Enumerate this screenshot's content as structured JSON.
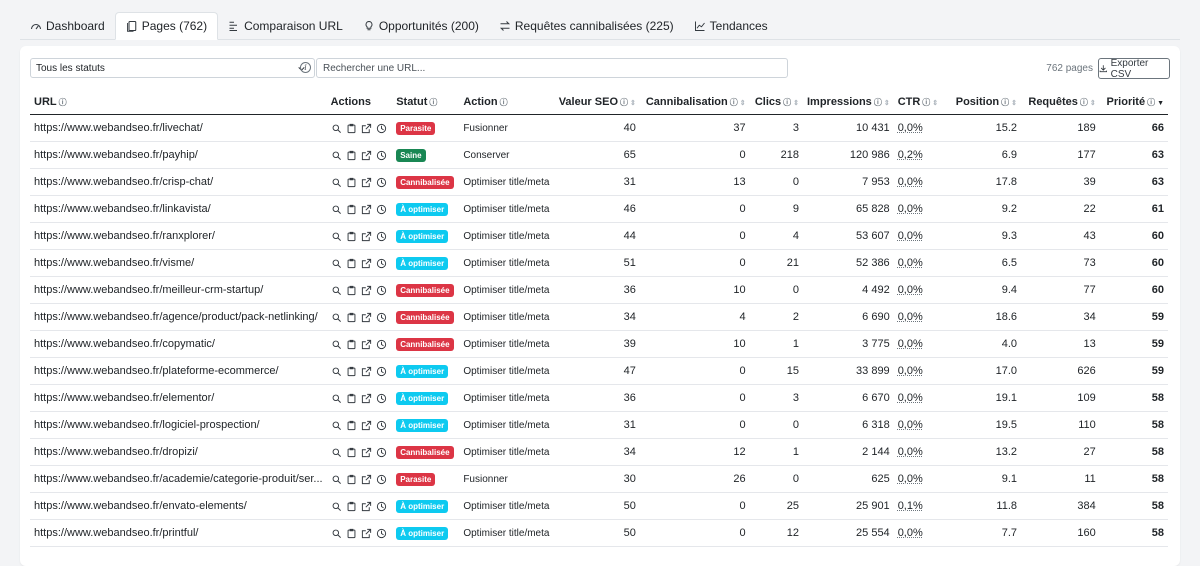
{
  "tabs": [
    {
      "label": "Dashboard",
      "icon": "gauge-icon"
    },
    {
      "label": "Pages (762)",
      "icon": "pages-icon",
      "active": true
    },
    {
      "label": "Comparaison URL",
      "icon": "compare-icon"
    },
    {
      "label": "Opportunités (200)",
      "icon": "lightbulb-icon"
    },
    {
      "label": "Requêtes cannibalisées (225)",
      "icon": "swap-icon"
    },
    {
      "label": "Tendances",
      "icon": "trend-icon"
    }
  ],
  "toolbar": {
    "status_filter": "Tous les statuts",
    "search_placeholder": "Rechercher une URL...",
    "count": "762 pages",
    "export_label": "Exporter CSV"
  },
  "columns": [
    "URL",
    "Actions",
    "Statut",
    "Action",
    "Valeur SEO",
    "Cannibalisation",
    "Clics",
    "Impressions",
    "CTR",
    "Position",
    "Requêtes",
    "Priorité"
  ],
  "status_colors": {
    "Parasite": "#dc3545",
    "Saine": "#198754",
    "Cannibalisée": "#dc3545",
    "À optimiser": "#0dcaf0"
  },
  "rows": [
    {
      "url": "https://www.webandseo.fr/livechat/",
      "statut": "Parasite",
      "action": "Fusionner",
      "seo": "40",
      "canni": "37",
      "clics": "3",
      "impr": "10 431",
      "ctr": "0,0%",
      "pos": "15.2",
      "req": "189",
      "prio": "66"
    },
    {
      "url": "https://www.webandseo.fr/payhip/",
      "statut": "Saine",
      "action": "Conserver",
      "seo": "65",
      "canni": "0",
      "clics": "218",
      "impr": "120 986",
      "ctr": "0,2%",
      "pos": "6.9",
      "req": "177",
      "prio": "63"
    },
    {
      "url": "https://www.webandseo.fr/crisp-chat/",
      "statut": "Cannibalisée",
      "action": "Optimiser title/meta",
      "seo": "31",
      "canni": "13",
      "clics": "0",
      "impr": "7 953",
      "ctr": "0,0%",
      "pos": "17.8",
      "req": "39",
      "prio": "63"
    },
    {
      "url": "https://www.webandseo.fr/linkavista/",
      "statut": "À optimiser",
      "action": "Optimiser title/meta",
      "seo": "46",
      "canni": "0",
      "clics": "9",
      "impr": "65 828",
      "ctr": "0,0%",
      "pos": "9.2",
      "req": "22",
      "prio": "61"
    },
    {
      "url": "https://www.webandseo.fr/ranxplorer/",
      "statut": "À optimiser",
      "action": "Optimiser title/meta",
      "seo": "44",
      "canni": "0",
      "clics": "4",
      "impr": "53 607",
      "ctr": "0,0%",
      "pos": "9.3",
      "req": "43",
      "prio": "60"
    },
    {
      "url": "https://www.webandseo.fr/visme/",
      "statut": "À optimiser",
      "action": "Optimiser title/meta",
      "seo": "51",
      "canni": "0",
      "clics": "21",
      "impr": "52 386",
      "ctr": "0,0%",
      "pos": "6.5",
      "req": "73",
      "prio": "60"
    },
    {
      "url": "https://www.webandseo.fr/meilleur-crm-startup/",
      "statut": "Cannibalisée",
      "action": "Optimiser title/meta",
      "seo": "36",
      "canni": "10",
      "clics": "0",
      "impr": "4 492",
      "ctr": "0,0%",
      "pos": "9.4",
      "req": "77",
      "prio": "60"
    },
    {
      "url": "https://www.webandseo.fr/agence/product/pack-netlinking/",
      "statut": "Cannibalisée",
      "action": "Optimiser title/meta",
      "seo": "34",
      "canni": "4",
      "clics": "2",
      "impr": "6 690",
      "ctr": "0,0%",
      "pos": "18.6",
      "req": "34",
      "prio": "59"
    },
    {
      "url": "https://www.webandseo.fr/copymatic/",
      "statut": "Cannibalisée",
      "action": "Optimiser title/meta",
      "seo": "39",
      "canni": "10",
      "clics": "1",
      "impr": "3 775",
      "ctr": "0,0%",
      "pos": "4.0",
      "req": "13",
      "prio": "59"
    },
    {
      "url": "https://www.webandseo.fr/plateforme-ecommerce/",
      "statut": "À optimiser",
      "action": "Optimiser title/meta",
      "seo": "47",
      "canni": "0",
      "clics": "15",
      "impr": "33 899",
      "ctr": "0,0%",
      "pos": "17.0",
      "req": "626",
      "prio": "59"
    },
    {
      "url": "https://www.webandseo.fr/elementor/",
      "statut": "À optimiser",
      "action": "Optimiser title/meta",
      "seo": "36",
      "canni": "0",
      "clics": "3",
      "impr": "6 670",
      "ctr": "0,0%",
      "pos": "19.1",
      "req": "109",
      "prio": "58"
    },
    {
      "url": "https://www.webandseo.fr/logiciel-prospection/",
      "statut": "À optimiser",
      "action": "Optimiser title/meta",
      "seo": "31",
      "canni": "0",
      "clics": "0",
      "impr": "6 318",
      "ctr": "0,0%",
      "pos": "19.5",
      "req": "110",
      "prio": "58"
    },
    {
      "url": "https://www.webandseo.fr/dropizi/",
      "statut": "Cannibalisée",
      "action": "Optimiser title/meta",
      "seo": "34",
      "canni": "12",
      "clics": "1",
      "impr": "2 144",
      "ctr": "0,0%",
      "pos": "13.2",
      "req": "27",
      "prio": "58"
    },
    {
      "url": "https://www.webandseo.fr/academie/categorie-produit/ser...",
      "statut": "Parasite",
      "action": "Fusionner",
      "seo": "30",
      "canni": "26",
      "clics": "0",
      "impr": "625",
      "ctr": "0,0%",
      "pos": "9.1",
      "req": "11",
      "prio": "58"
    },
    {
      "url": "https://www.webandseo.fr/envato-elements/",
      "statut": "À optimiser",
      "action": "Optimiser title/meta",
      "seo": "50",
      "canni": "0",
      "clics": "25",
      "impr": "25 901",
      "ctr": "0,1%",
      "pos": "11.8",
      "req": "384",
      "prio": "58"
    },
    {
      "url": "https://www.webandseo.fr/printful/",
      "statut": "À optimiser",
      "action": "Optimiser title/meta",
      "seo": "50",
      "canni": "0",
      "clics": "12",
      "impr": "25 554",
      "ctr": "0,0%",
      "pos": "7.7",
      "req": "160",
      "prio": "58"
    }
  ]
}
